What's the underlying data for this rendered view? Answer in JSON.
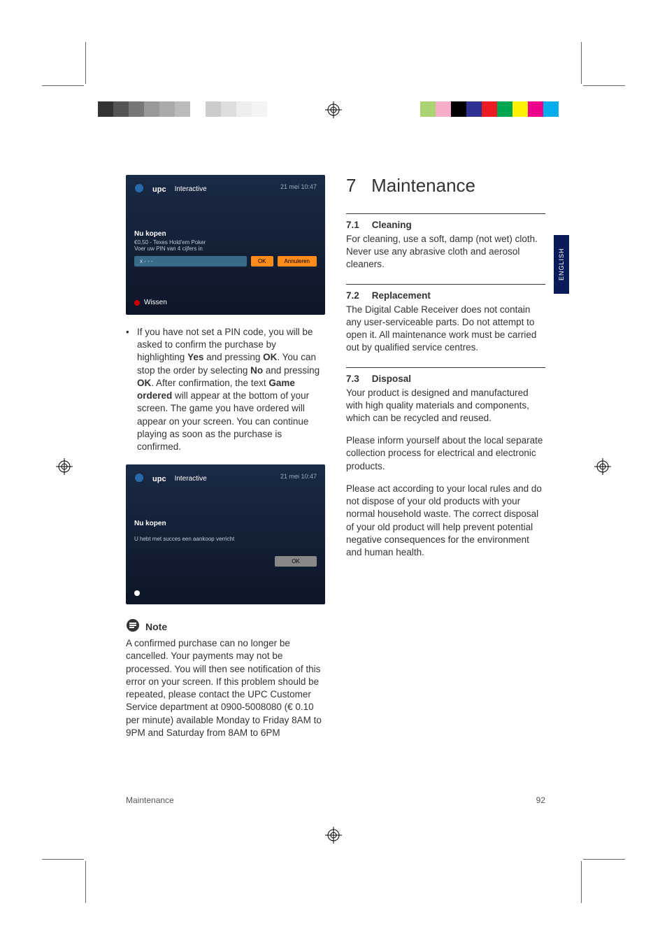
{
  "crop_colors_left": [
    "#333333",
    "#555555",
    "#777777",
    "#999999",
    "#aaaaaa",
    "#bbbbbb",
    "#ffffff",
    "#cccccc",
    "#dddddd",
    "#eeeeee",
    "#f4f4f4",
    "#ffffff"
  ],
  "crop_colors_right": [
    "#00aeef",
    "#ec008c",
    "#fff200",
    "#00a651",
    "#ed1c24",
    "#2e3192",
    "#000000",
    "#f7adc9",
    "#abd373",
    "#ffffff"
  ],
  "upc1": {
    "brand": "upc",
    "title": "Interactive",
    "time": "21 mei 10:47",
    "heading": "Nu kopen",
    "sub1": "€0,50 - Texes Hold'em Poker",
    "sub2": "Voer uw PIN van 4 cijfers in",
    "field": "x - - -",
    "ok": "OK",
    "cancel": "Annuleren",
    "footer": "Wissen"
  },
  "upc2": {
    "brand": "upc",
    "title": "Interactive",
    "time": "21 mei 10:47",
    "heading": "Nu kopen",
    "msg": "U hebt met succes een aankoop verricht",
    "ok": "OK"
  },
  "bullet_text": {
    "pre": "If you have not set a PIN code, you will be asked to confirm the purchase by highlighting ",
    "yes": "Yes",
    "mid1": " and pressing ",
    "ok1": "OK",
    "mid2": ". You can stop the order by selecting ",
    "no": "No",
    "mid3": " and pressing ",
    "ok2": "OK",
    "mid4": ". After confirmation, the text ",
    "ordered": "Game ordered",
    "post": " will appear at the bottom of your screen. The game you have ordered will appear on your screen. You can continue playing as soon as the purchase is confirmed."
  },
  "note_label": "Note",
  "note_text": "A confirmed purchase can no longer be cancelled. Your payments may not be processed. You will then see notification of this error on your screen. If this problem should be repeated, please contact the UPC Customer Service department at 0900-5008080 (€ 0.10 per minute) available Monday to Friday 8AM to 9PM and Saturday from 8AM to 6PM",
  "section": {
    "num": "7",
    "title": "Maintenance"
  },
  "s71": {
    "num": "7.1",
    "title": "Cleaning",
    "body": "For cleaning, use a soft, damp (not wet) cloth. Never use any abrasive cloth and aerosol cleaners."
  },
  "s72": {
    "num": "7.2",
    "title": "Replacement",
    "body": "The Digital Cable Receiver does not contain any user-serviceable parts. Do not attempt to open it. All maintenance work must be carried out by qualified service centres."
  },
  "s73": {
    "num": "7.3",
    "title": "Disposal",
    "p1": "Your product is designed and manufactured with high quality materials and components, which can be recycled and reused.",
    "p2": "Please inform yourself about the local separate collection process for electrical and electronic products.",
    "p3": "Please act according to your local rules and do not dispose of your old products with your normal household waste. The correct disposal of your old product will help prevent potential negative consequences for the environment and human health."
  },
  "lang_tab": "ENGLISH",
  "footer_left": "Maintenance",
  "footer_right": "92"
}
